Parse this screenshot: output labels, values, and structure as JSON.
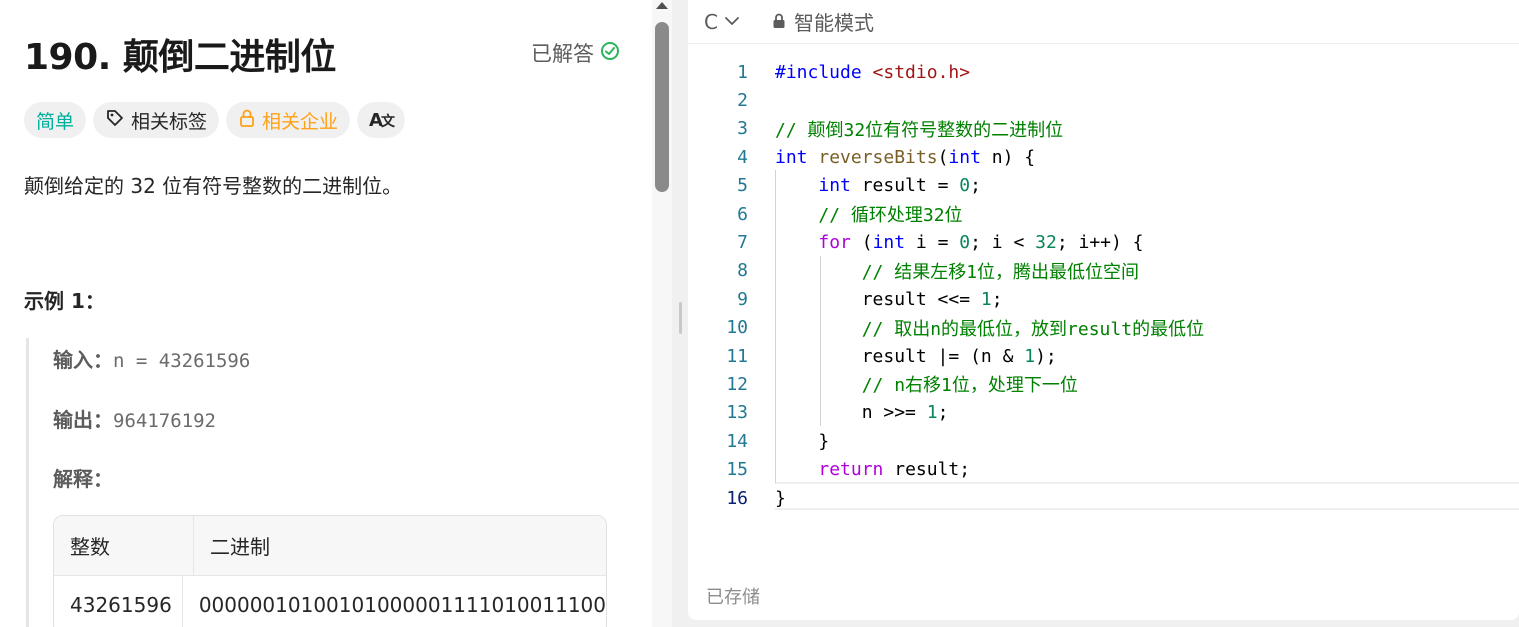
{
  "problem": {
    "title": "190. 颠倒二进制位",
    "solved_label": "已解答",
    "tags": {
      "difficulty": "简单",
      "topics": "相关标签",
      "companies": "相关企业",
      "translate": "A文"
    },
    "description": "颠倒给定的 32 位有符号整数的二进制位。",
    "example": {
      "title": "示例 1：",
      "input_label": "输入：",
      "input_value": "n = 43261596",
      "output_label": "输出：",
      "output_value": "964176192",
      "explain_label": "解释：",
      "table": {
        "headers": [
          "整数",
          "二进制"
        ],
        "rows": [
          [
            "43261596",
            "00000010100101000001111010011100"
          ]
        ]
      }
    }
  },
  "editor": {
    "language": "C",
    "mode": "智能模式",
    "status": "已存储",
    "line_numbers": [
      "1",
      "2",
      "3",
      "4",
      "5",
      "6",
      "7",
      "8",
      "9",
      "10",
      "11",
      "12",
      "13",
      "14",
      "15",
      "16"
    ]
  },
  "colors": {
    "easy": "#00af9b",
    "company": "#ffa116",
    "solved_check": "#2db55d",
    "keyword": "#0000ff",
    "control": "#af00db",
    "function": "#795e26",
    "number": "#098658",
    "comment": "#008000",
    "string": "#a31515"
  }
}
